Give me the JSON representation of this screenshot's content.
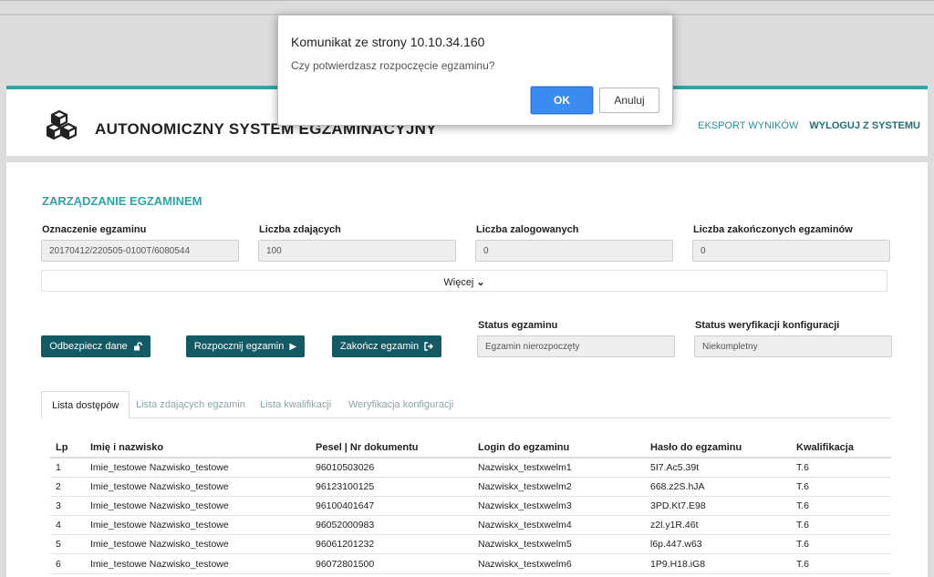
{
  "dialog": {
    "title": "Komunikat ze strony 10.10.34.160",
    "message": "Czy potwierdzasz rozpoczęcie egzaminu?",
    "ok_label": "OK",
    "cancel_label": "Anuluj"
  },
  "header": {
    "title": "AUTONOMICZNY SYSTEM EGZAMINACYJNY",
    "nav": {
      "export": "EKSPORT WYNIKÓW",
      "logout": "WYLOGUJ Z SYSTEMU"
    }
  },
  "main": {
    "section_title": "ZARZĄDZANIE EGZAMINEM",
    "fields": [
      {
        "label": "Oznaczenie egzaminu",
        "value": "20170412/220505-0100T/6080544"
      },
      {
        "label": "Liczba zdających",
        "value": "100"
      },
      {
        "label": "Liczba zalogowanych",
        "value": "0"
      },
      {
        "label": "Liczba zakończonych egzaminów",
        "value": "0"
      }
    ],
    "more_label": "Więcej",
    "buttons": {
      "unlock": "Odbezpiecz dane",
      "start": "Rozpocznij egzamin",
      "finish": "Zakończ egzamin"
    },
    "status": [
      {
        "label": "Status egzaminu",
        "value": "Egzamin nierozpoczęty"
      },
      {
        "label": "Status weryfikacji konfiguracji",
        "value": "Niekompletny"
      }
    ],
    "tabs": [
      "Lista dostępów",
      "Lista zdających egzamin",
      "Lista kwalifikacji",
      "Weryfikacja konfiguracji"
    ],
    "table": {
      "headers": [
        "Lp",
        "Imię i nazwisko",
        "Pesel | Nr dokumentu",
        "Login do egzaminu",
        "Hasło do egzaminu",
        "Kwalifikacja"
      ],
      "rows": [
        [
          "1",
          "Imie_testowe Nazwisko_testowe",
          "96010503026",
          "Nazwiskx_testxwelm1",
          "5I7.Ac5.39t",
          "T.6"
        ],
        [
          "2",
          "Imie_testowe Nazwisko_testowe",
          "96123100125",
          "Nazwiskx_testxwelm2",
          "668.z2S.hJA",
          "T.6"
        ],
        [
          "3",
          "Imie_testowe Nazwisko_testowe",
          "96100401647",
          "Nazwiskx_testxwelm3",
          "3PD.Kt7.E98",
          "T.6"
        ],
        [
          "4",
          "Imie_testowe Nazwisko_testowe",
          "96052000983",
          "Nazwiskx_testxwelm4",
          "z2l.y1R.46t",
          "T.6"
        ],
        [
          "5",
          "Imie_testowe Nazwisko_testowe",
          "96061201232",
          "Nazwiskx_testxwelm5",
          "l6p.447.w63",
          "T.6"
        ],
        [
          "6",
          "Imie_testowe Nazwisko_testowe",
          "96072801500",
          "Nazwiskx_testxwelm6",
          "1P9.H18.iG8",
          "T.6"
        ]
      ]
    }
  },
  "colors": {
    "accent": "#2aa6a6",
    "button_dark": "#135a65",
    "dialog_ok": "#3c8bf0"
  },
  "icons": {
    "logo": "cubes-icon",
    "unlock": "unlock-icon",
    "start": "play-icon",
    "finish": "sign-out-icon",
    "more": "chevron-down-icon"
  }
}
